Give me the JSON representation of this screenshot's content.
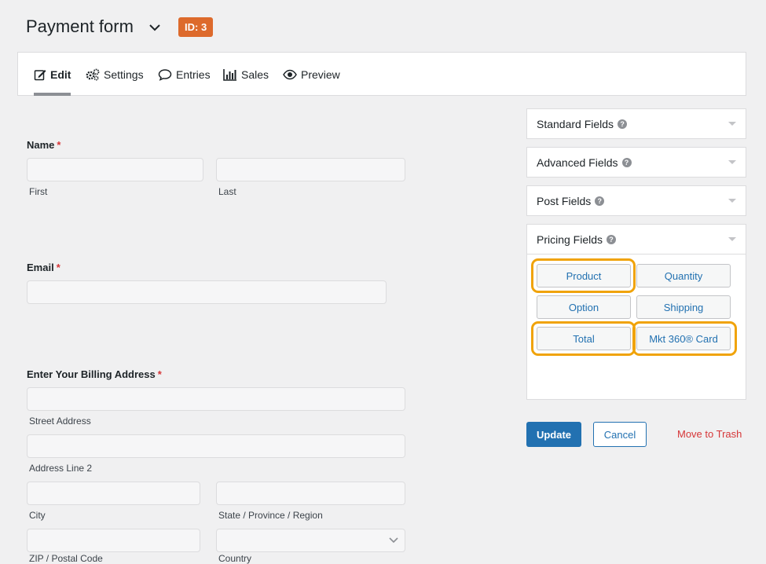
{
  "header": {
    "title": "Payment form",
    "id_badge": "ID: 3"
  },
  "tabs": [
    {
      "label": "Edit",
      "icon": "edit-icon"
    },
    {
      "label": "Settings",
      "icon": "gear-icon"
    },
    {
      "label": "Entries",
      "icon": "comment-icon"
    },
    {
      "label": "Sales",
      "icon": "chart-icon"
    },
    {
      "label": "Preview",
      "icon": "eye-icon"
    }
  ],
  "form": {
    "name": {
      "label": "Name",
      "required": "*",
      "first": "First",
      "last": "Last"
    },
    "email": {
      "label": "Email",
      "required": "*"
    },
    "address": {
      "label": "Enter Your Billing Address",
      "required": "*",
      "street": "Street Address",
      "line2": "Address Line 2",
      "city": "City",
      "state": "State / Province / Region",
      "zip": "ZIP / Postal Code",
      "country": "Country"
    }
  },
  "sidebar": {
    "panels": [
      "Standard Fields",
      "Advanced Fields",
      "Post Fields",
      "Pricing Fields"
    ],
    "pricing_buttons": [
      "Product",
      "Quantity",
      "Option",
      "Shipping",
      "Total",
      "Mkt 360® Card"
    ]
  },
  "actions": {
    "update": "Update",
    "cancel": "Cancel",
    "trash": "Move to Trash"
  },
  "colors": {
    "accent": "#2271b1",
    "badge": "#dd6a2c",
    "highlight": "#f0a30a",
    "danger": "#d63638"
  }
}
